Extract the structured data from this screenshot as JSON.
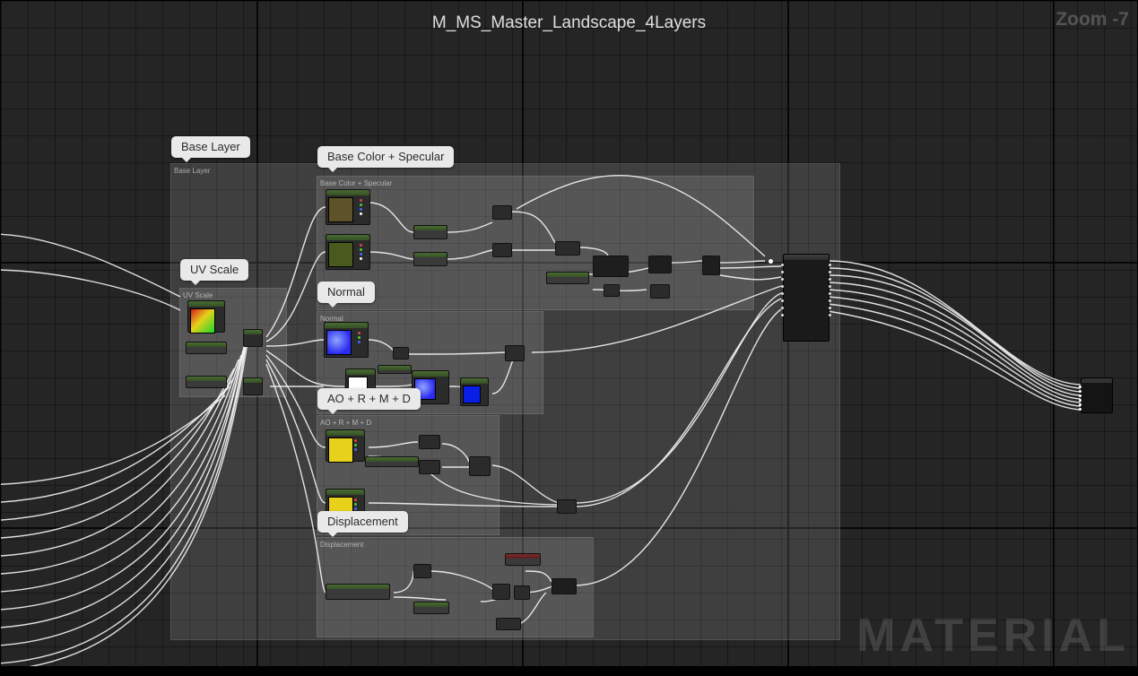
{
  "title": "M_MS_Master_Landscape_4Layers",
  "zoom": "Zoom -7",
  "watermark": "MATERIAL",
  "labels": {
    "base_layer": "Base Layer",
    "base_color": "Base Color + Specular",
    "uv_scale": "UV Scale",
    "normal": "Normal",
    "aordo": "AO + R + M + D",
    "displacement": "Displacement"
  },
  "frames": {
    "base_layer": "Base Layer",
    "base_color": "Base Color + Specular",
    "uv_scale": "UV Scale",
    "normal": "Normal",
    "aordo": "AO + R + M + D",
    "displacement": "Displacement"
  }
}
